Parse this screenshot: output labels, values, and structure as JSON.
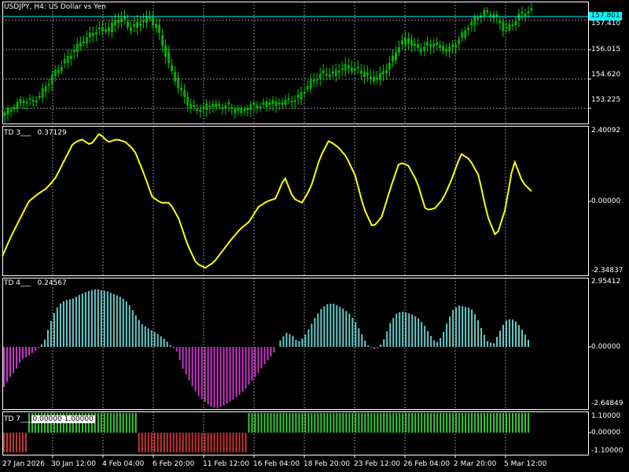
{
  "symbol_title": "USDJPY, H4:  US Dollar vs Yen",
  "current_price": "157.801",
  "colors": {
    "background": "#000000",
    "frame": "#ffffff",
    "grid": "#8c8c8c",
    "bull_candle": "#00cc00",
    "price_line": "#00ffff",
    "td3_line": "#ffff00",
    "td4_positive": "#66cccc",
    "td4_negative": "#cc33cc",
    "td7_positive": "#33cc33",
    "td7_negative": "#cc3333"
  },
  "price_axis": [
    "157.410",
    "156.015",
    "154.620",
    "153.225"
  ],
  "td3": {
    "name": "TD 3___",
    "value": "0.37129",
    "axis_max": "2.40092",
    "axis_zero": "0.00000",
    "axis_min": "-2.34837",
    "series": [
      -1.9,
      -1.2,
      -0.6,
      0.0,
      0.25,
      0.45,
      0.8,
      1.4,
      2.0,
      2.15,
      1.95,
      2.35,
      2.05,
      2.15,
      2.05,
      1.75,
      1.0,
      0.15,
      -0.05,
      -0.05,
      -0.6,
      -1.5,
      -2.15,
      -2.3,
      -2.1,
      -1.7,
      -1.3,
      -0.95,
      -0.7,
      -0.2,
      0.0,
      0.1,
      0.85,
      0.1,
      -0.05,
      0.5,
      1.5,
      2.1,
      1.9,
      1.55,
      0.9,
      -0.25,
      -0.9,
      -0.55,
      0.45,
      1.35,
      1.25,
      0.7,
      -0.3,
      -0.25,
      0.1,
      0.8,
      1.65,
      1.45,
      0.9,
      -0.5,
      -1.25,
      -0.3,
      1.45,
      0.65,
      0.35
    ]
  },
  "td4": {
    "name": "TD 4___",
    "value": "0.24567",
    "axis_max": "2.95412",
    "axis_zero": "0.00000",
    "axis_min": "-2.64849",
    "series": [
      -1.7,
      -1.3,
      -1.0,
      -0.55,
      -0.4,
      -0.25,
      -0.05,
      0.25,
      1.0,
      1.6,
      1.9,
      2.0,
      2.05,
      2.2,
      2.3,
      2.4,
      2.45,
      2.4,
      2.35,
      2.25,
      2.15,
      2.0,
      1.7,
      1.3,
      0.95,
      0.8,
      0.65,
      0.5,
      0.3,
      0.05,
      -0.2,
      -0.9,
      -1.35,
      -1.8,
      -2.15,
      -2.35,
      -2.55,
      -2.6,
      -2.5,
      -2.35,
      -2.2,
      -2.0,
      -1.75,
      -1.45,
      -1.15,
      -0.8,
      -0.5,
      -0.2,
      0.3,
      0.6,
      0.5,
      0.2,
      0.4,
      0.8,
      1.25,
      1.6,
      1.8,
      1.85,
      1.75,
      1.6,
      1.4,
      1.05,
      0.6,
      0.1,
      -0.1,
      -0.05,
      0.35,
      1.0,
      1.4,
      1.5,
      1.45,
      1.35,
      1.2,
      0.9,
      0.5,
      0.15,
      0.45,
      1.1,
      1.6,
      1.75,
      1.7,
      1.65,
      1.3,
      0.7,
      0.2,
      0.15,
      0.65,
      1.1,
      1.2,
      1.05,
      0.7,
      0.3
    ]
  },
  "td7": {
    "name": "TD 7___",
    "values_text": "0.00000 1.00000",
    "axis_max": "1.10000",
    "axis_zero": "0.00000",
    "axis_min": "-1.10000",
    "segments": [
      {
        "from": 0,
        "to": 0.046,
        "sign": -1
      },
      {
        "from": 0.046,
        "to": 0.254,
        "sign": 1
      },
      {
        "from": 0.254,
        "to": 0.467,
        "sign": -1
      },
      {
        "from": 0.467,
        "to": 1.0,
        "sign": 1
      }
    ]
  },
  "time_axis": [
    "27 Jan 2026",
    "30 Jan 12:00",
    "4 Feb 04:00",
    "6 Feb 20:00",
    "11 Feb 12:00",
    "16 Feb 04:00",
    "18 Feb 20:00",
    "23 Feb 12:00",
    "26 Feb 04:00",
    "2 Mar 20:00",
    "5 Mar 12:00"
  ],
  "price_series": [
    153.0,
    153.2,
    153.5,
    153.6,
    153.55,
    153.8,
    154.3,
    154.8,
    155.2,
    155.6,
    156.0,
    156.35,
    156.6,
    156.9,
    157.0,
    156.95,
    157.4,
    157.5,
    157.0,
    157.2,
    157.4,
    157.5,
    157.0,
    156.0,
    155.0,
    154.3,
    153.7,
    153.2,
    153.15,
    153.3,
    153.4,
    153.25,
    153.4,
    153.15,
    153.1,
    153.25,
    153.4,
    153.3,
    153.55,
    153.4,
    153.5,
    153.6,
    153.65,
    154.0,
    154.4,
    154.7,
    154.9,
    154.8,
    155.0,
    155.2,
    155.1,
    155.05,
    154.8,
    154.6,
    154.7,
    155.1,
    155.6,
    156.3,
    156.5,
    156.2,
    156.0,
    156.25,
    156.3,
    156.05,
    156.0,
    156.3,
    156.7,
    157.2,
    157.5,
    157.8,
    157.7,
    157.5,
    157.0,
    157.1,
    157.6,
    157.8,
    157.85
  ]
}
